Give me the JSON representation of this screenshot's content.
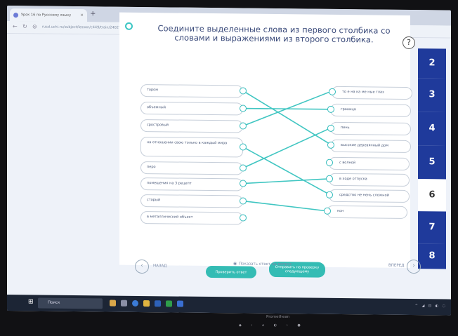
{
  "browser": {
    "tab_title": "Урок 16 по Русскому языку",
    "tab_close": "×",
    "new_tab": "+",
    "url": "rusd.uchi.ru/subject/lesson/c449/train/240275/"
  },
  "question": {
    "title": "Соедините выделенные слова из первого столбика со словами и выражениями из второго столбика.",
    "help": "?"
  },
  "left_items": [
    "тором",
    "объемный",
    "сростровый",
    "на отношении свою только в каждый мира",
    "перо",
    "помещения на 3 рецепт",
    "старый",
    "в металлический объект"
  ],
  "right_items": [
    "то е на ка ме ные глаз",
    "граница",
    "пень",
    "высокие деревянный дом",
    "с волной",
    "в ходе отпуска",
    "средство не нень сложной",
    "кон"
  ],
  "nav": {
    "questions": [
      "2",
      "3",
      "4",
      "5",
      "6",
      "7",
      "8"
    ],
    "current": "6"
  },
  "actions": {
    "check_label": "Проверить ответ",
    "send_label": "Отправить на проверку следующему",
    "back_label": "НАЗАД",
    "next_label": "ВПЕРЕД",
    "skip_label": "Показать ответ на вопрос"
  },
  "taskbar": {
    "search_placeholder": "Поиск"
  },
  "monitor": {
    "brand": "Promethean"
  },
  "colors": {
    "accent": "#34bcb4",
    "nav_active": "#1f3a9b"
  }
}
